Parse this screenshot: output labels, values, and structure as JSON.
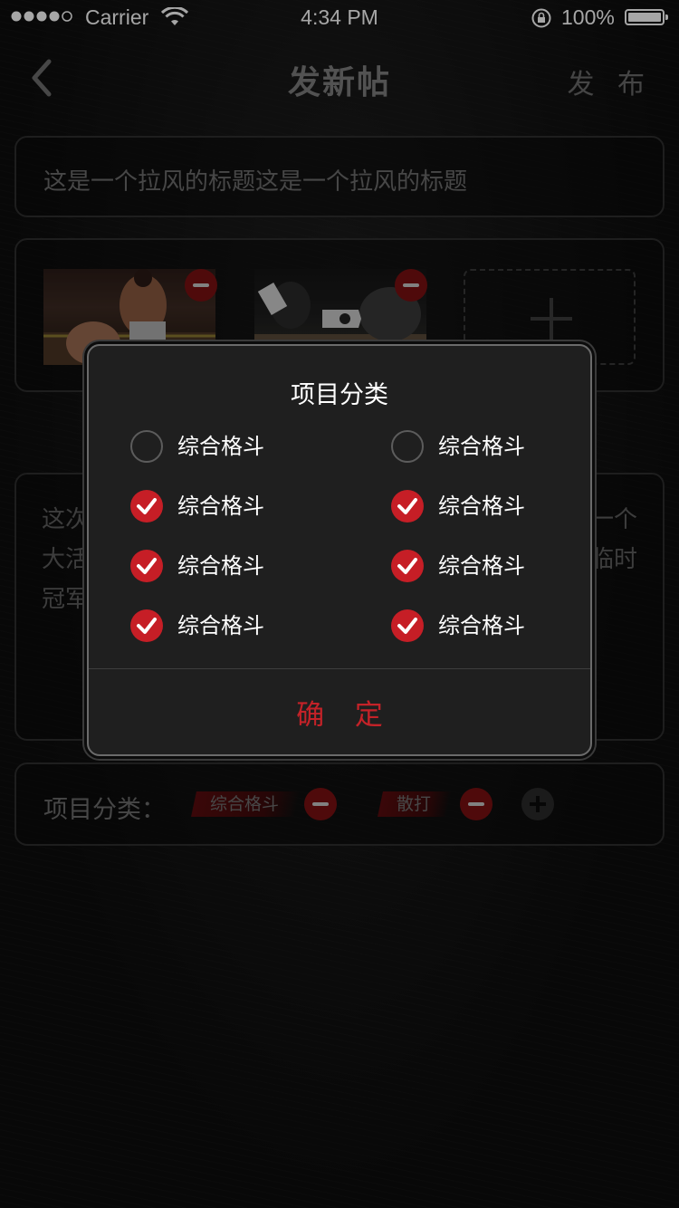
{
  "status_bar": {
    "carrier": "Carrier",
    "time": "4:34 PM",
    "battery": "100%"
  },
  "nav": {
    "title": "发新帖",
    "publish": "发 布"
  },
  "post": {
    "title_value": "这是一个拉风的标题这是一个拉风的标题",
    "content_visible": "这次                                                    一个\n大活                                                    临时\n冠军"
  },
  "category": {
    "label": "项目分类：",
    "tags": [
      "综合格斗",
      "散打"
    ]
  },
  "dialog": {
    "title": "项目分类",
    "options": [
      {
        "label": "综合格斗",
        "checked": false
      },
      {
        "label": "综合格斗",
        "checked": false
      },
      {
        "label": "综合格斗",
        "checked": true
      },
      {
        "label": "综合格斗",
        "checked": true
      },
      {
        "label": "综合格斗",
        "checked": true
      },
      {
        "label": "综合格斗",
        "checked": true
      },
      {
        "label": "综合格斗",
        "checked": true
      },
      {
        "label": "综合格斗",
        "checked": true
      }
    ],
    "confirm": "确 定"
  },
  "colors": {
    "accent_red": "#c61e26",
    "background": "#0d0d0d",
    "dialog_bg": "#1f1f1f"
  },
  "icons": [
    "back-chevron-icon",
    "minus-circle-icon",
    "plus-icon",
    "check-icon",
    "wifi-icon",
    "signal-dots-icon",
    "battery-icon",
    "rotation-lock-icon"
  ]
}
